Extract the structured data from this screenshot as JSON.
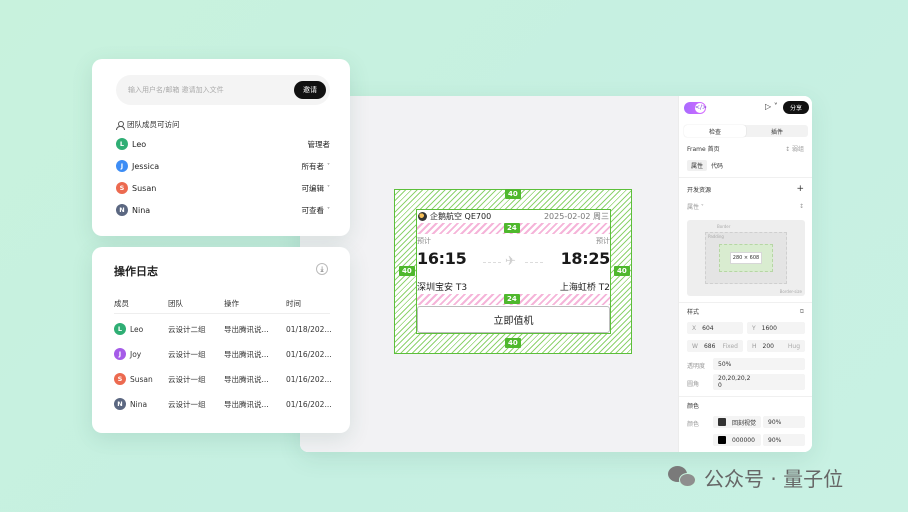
{
  "members_panel": {
    "invite_placeholder": "输入用户名/邮箱 邀请加入文件",
    "invite_button": "邀请",
    "access_title": "团队成员可访问",
    "members": [
      {
        "initial": "L",
        "name": "Leo",
        "role": "管理者",
        "has_dropdown": false,
        "color": "#2fae74"
      },
      {
        "initial": "J",
        "name": "Jessica",
        "role": "所有者",
        "has_dropdown": true,
        "color": "#3d8df5"
      },
      {
        "initial": "S",
        "name": "Susan",
        "role": "可编辑",
        "has_dropdown": true,
        "color": "#ec6a50"
      },
      {
        "initial": "N",
        "name": "Nina",
        "role": "可查看",
        "has_dropdown": true,
        "color": "#5b6781"
      }
    ]
  },
  "log_panel": {
    "title": "操作日志",
    "headers": [
      "成员",
      "团队",
      "操作",
      "时间"
    ],
    "rows": [
      {
        "initial": "L",
        "member": "Leo",
        "team": "云设计二组",
        "action": "导出腾讯说...",
        "time": "01/18/202...",
        "color": "#2fae74"
      },
      {
        "initial": "J",
        "member": "Joy",
        "team": "云设计一组",
        "action": "导出腾讯说...",
        "time": "01/16/202...",
        "color": "#a55be8"
      },
      {
        "initial": "S",
        "member": "Susan",
        "team": "云设计一组",
        "action": "导出腾讯说...",
        "time": "01/16/202...",
        "color": "#ec6a50"
      },
      {
        "initial": "N",
        "member": "Nina",
        "team": "云设计一组",
        "action": "导出腾讯说...",
        "time": "01/16/202...",
        "color": "#5b6781"
      }
    ]
  },
  "canvas": {
    "padding_tags": {
      "top": "40",
      "bottom": "40",
      "left": "40",
      "right": "40",
      "inner_top": "24",
      "inner_bottom": "24"
    },
    "ticket": {
      "airline": "企鹅航空 QE700",
      "date": "2025-02-02 周三",
      "dep_label": "预计",
      "arr_label": "预计",
      "dep_time": "16:15",
      "arr_time": "18:25",
      "dep_airport": "深圳宝安 T3",
      "arr_airport": "上海虹桥 T2",
      "checkin_button": "立即值机"
    }
  },
  "inspector": {
    "share_button": "分享",
    "tabs": [
      "检查",
      "插件"
    ],
    "frame_label": "Frame 首页",
    "frame_action": "↕ 弱组",
    "sub_tabs": [
      "属性",
      "代码"
    ],
    "dev_assets": "开发资源",
    "add_icon": "+",
    "props_label": "属性",
    "box_labels": {
      "border": "Border",
      "padding": "Padding",
      "size": "280 × 608",
      "border_size": "Border-size"
    },
    "style_label": "样式",
    "fields": {
      "x_key": "X",
      "x_val": "604",
      "y_key": "Y",
      "y_val": "1600",
      "w_key": "W",
      "w_val": "686",
      "w_hint": "Fixed",
      "h_key": "H",
      "h_val": "200",
      "h_hint": "Hug",
      "opacity_key": "透明度",
      "opacity_val": "50%",
      "radius_key": "圆角",
      "radius_val": "20,20,20,2\n0"
    },
    "color_section": "颜色",
    "color_key": "颜色",
    "colors": [
      {
        "name": "回刻视觉",
        "opacity": "90%",
        "hex": "#333333"
      },
      {
        "name": "000000",
        "opacity": "90%",
        "hex": "#000000"
      }
    ],
    "accent": "#b06cff"
  },
  "watermark": {
    "text": "公众号 · 量子位"
  }
}
